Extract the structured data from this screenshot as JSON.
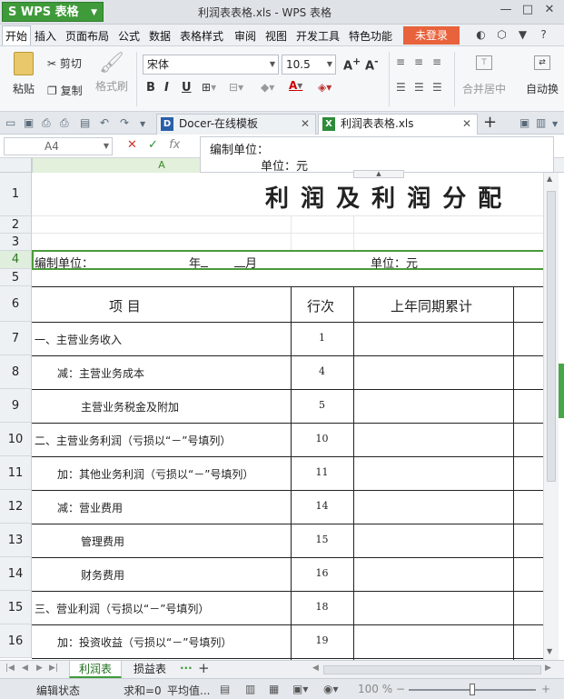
{
  "titlebar": {
    "app_label": "WPS 表格",
    "doc_title": "利润表表格.xls - WPS 表格",
    "minimize": "—",
    "maximize": "□",
    "close": "✕"
  },
  "menubar": {
    "items": [
      "开始",
      "插入",
      "页面布局",
      "公式",
      "数据",
      "表格样式",
      "审阅",
      "视图",
      "开发工具",
      "特色功能"
    ],
    "login": "未登录"
  },
  "ribbon": {
    "paste": "粘贴",
    "cut": "剪切",
    "copy": "复制",
    "format_painter": "格式刷",
    "font": "宋体",
    "font_size": "10.5",
    "bold": "B",
    "italic": "I",
    "underline": "U",
    "merge": "合并居中",
    "wrap": "自动换"
  },
  "tabs": [
    {
      "label": "Docer-在线模板",
      "icon": "D"
    },
    {
      "label": "利润表表格.xls",
      "icon": "X"
    }
  ],
  "formula_bar": {
    "cell_ref": "A4",
    "fx": "fx"
  },
  "tooltip": {
    "line1": "编制单位：",
    "line2": "单位：元"
  },
  "column_header": "A",
  "sheet": {
    "title": "利 润 及 利 润 分 配",
    "row4": {
      "left": "编制单位：",
      "mid1": "年",
      "mid2": "月",
      "right": "单位：元"
    },
    "headers": {
      "item": "项            目",
      "line": "行次",
      "prev": "上年同期累计"
    },
    "rows": [
      {
        "row": "7",
        "item": "一、主营业务收入",
        "line": "1"
      },
      {
        "row": "8",
        "item": "减：主营业务成本",
        "line": "4"
      },
      {
        "row": "9",
        "item": "主营业务税金及附加",
        "line": "5"
      },
      {
        "row": "10",
        "item": "二、主营业务利润（亏损以“－”号填列）",
        "line": "10"
      },
      {
        "row": "11",
        "item": "加：其他业务利润（亏损以“－”号填列）",
        "line": "11"
      },
      {
        "row": "12",
        "item": "减：营业费用",
        "line": "14"
      },
      {
        "row": "13",
        "item": "管理费用",
        "line": "15"
      },
      {
        "row": "14",
        "item": "财务费用",
        "line": "16"
      },
      {
        "row": "15",
        "item": "三、营业利润（亏损以“－”号填列）",
        "line": "18"
      },
      {
        "row": "16",
        "item": "加：投资收益（亏损以“－”号填列）",
        "line": "19"
      }
    ],
    "row_numbers": [
      "1",
      "2",
      "3",
      "4",
      "5",
      "6"
    ]
  },
  "sheet_tabs": [
    "利润表",
    "损益表"
  ],
  "status": {
    "mode": "编辑状态",
    "sum": "求和=0",
    "avg": "平均值...",
    "zoom": "100 %"
  },
  "colors": {
    "brand_green": "#3f9a3a",
    "login_orange": "#e8623b"
  }
}
